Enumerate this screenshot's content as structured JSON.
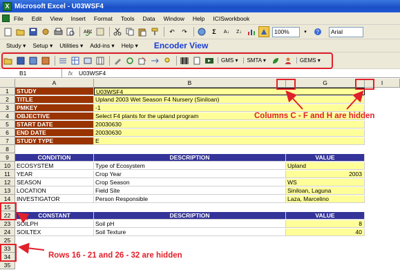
{
  "window": {
    "title": "Microsoft Excel - U03WSF4"
  },
  "menubar": {
    "items": [
      "File",
      "Edit",
      "View",
      "Insert",
      "Format",
      "Tools",
      "Data",
      "Window",
      "Help",
      "ICISworkbook"
    ]
  },
  "toolbar": {
    "zoom": "100%",
    "font": "Arial"
  },
  "addins_menus": [
    "Study ▾",
    "Setup ▾",
    "Utilities ▾",
    "Add-ins ▾",
    "Help ▾"
  ],
  "encoder_label": "Encoder View",
  "encoder_toolbar": {
    "gms": "GMS ▾",
    "smta": "SMTA ▾",
    "gems": "GEMS ▾"
  },
  "formula": {
    "name_box": "B1",
    "fx": "fx",
    "content": "U03WSF4"
  },
  "columns": {
    "a": "A",
    "b": "B",
    "g": "G",
    "i": "I"
  },
  "rows": [
    "1",
    "2",
    "3",
    "4",
    "5",
    "6",
    "7",
    "8",
    "9",
    "10",
    "11",
    "12",
    "13",
    "14",
    "15",
    "22",
    "23",
    "24",
    "25",
    "33",
    "34",
    "35"
  ],
  "study": [
    {
      "label": "STUDY",
      "value": "U03WSF4"
    },
    {
      "label": "TITLE",
      "value": "Upland 2003 Wet Season F4 Nursery (Siniloan)"
    },
    {
      "label": "PMKEY",
      "value": "-1"
    },
    {
      "label": "OBJECTIVE",
      "value": "Select F4 plants for the upland program"
    },
    {
      "label": "START DATE",
      "value": "20030630"
    },
    {
      "label": "END DATE",
      "value": "20030630"
    },
    {
      "label": "STUDY TYPE",
      "value": "E"
    }
  ],
  "conditions_header": {
    "name": "CONDITION",
    "description": "DESCRIPTION",
    "value": "VALUE"
  },
  "conditions": [
    {
      "name": "ECOSYSTEM",
      "description": "Type of Ecosystem",
      "value": "Upland"
    },
    {
      "name": "YEAR",
      "description": "Crop Year",
      "value": "2003"
    },
    {
      "name": "SEASON",
      "description": "Crop Season",
      "value": "WS"
    },
    {
      "name": "LOCATION",
      "description": "Field Site",
      "value": "Siniloan, Laguna"
    },
    {
      "name": "INVESTIGATOR",
      "description": "Person Responsible",
      "value": "Laza, Marcelino"
    }
  ],
  "constants_header": {
    "name": "CONSTANT",
    "description": "DESCRIPTION",
    "value": "VALUE"
  },
  "constants": [
    {
      "name": "SOILPH",
      "description": "Soil pH",
      "value": "8"
    },
    {
      "name": "SOILTEX",
      "description": "Soil Texture",
      "value": "40"
    }
  ],
  "annotations": {
    "hidden_columns": "Columns C - F and H are hidden",
    "hidden_rows": "Rows 16 - 21 and 26 - 32 are hidden"
  }
}
